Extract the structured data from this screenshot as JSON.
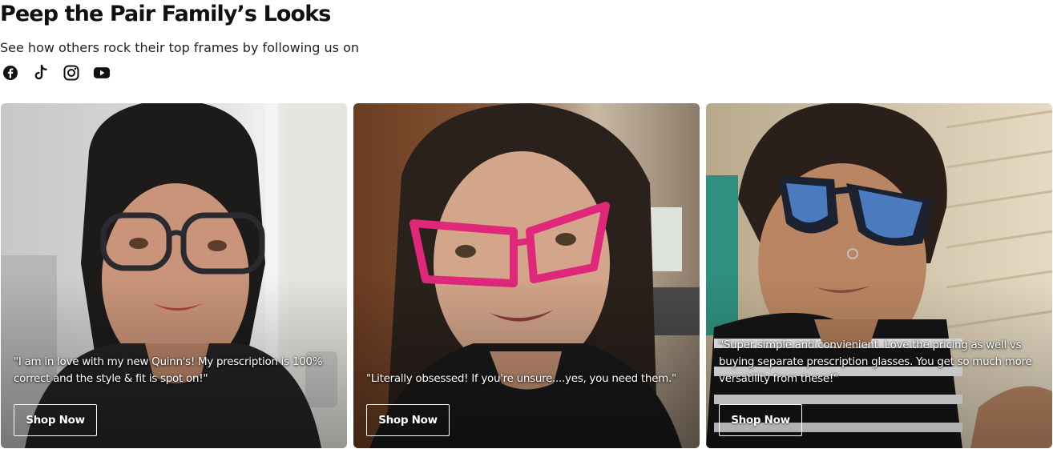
{
  "section": {
    "title": "Peep the Pair Family’s Looks",
    "subtitle": "See how others rock their top frames by following us on"
  },
  "socials": [
    {
      "icon": "facebook-icon"
    },
    {
      "icon": "tiktok-icon"
    },
    {
      "icon": "instagram-icon"
    },
    {
      "icon": "youtube-icon"
    }
  ],
  "cards": [
    {
      "quote": "\"I am in love with my new Quinn's! My prescription is 100% correct and the style & fit is spot on!\"",
      "button": "Shop Now",
      "frame_color": "#2a2a30"
    },
    {
      "quote": "\"Literally obsessed! If you're unsure....yes, you need them.\"",
      "button": "Shop Now",
      "frame_color": "#e0287a"
    },
    {
      "quote": "\"Super simple and convienient. Love the pricing as well vs buying separate prescription glasses. You get so much more versatility from these!\"",
      "button": "Shop Now",
      "frame_color": "#1c2230"
    }
  ]
}
